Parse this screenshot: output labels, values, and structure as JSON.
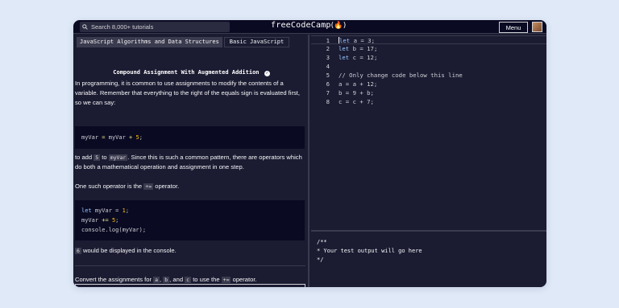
{
  "topbar": {
    "search_placeholder": "Search 8,000+ tutorials",
    "brand": "freeCodeCamp",
    "brand_flame": "(🔥)",
    "menu_label": "Menu"
  },
  "breadcrumb": {
    "superblock": "JavaScript Algorithms and Data Structures",
    "block": "Basic JavaScript"
  },
  "lesson": {
    "title": "Compound Assignment With Augmented Addition",
    "check": "✓",
    "p1": "In programming, it is common to use assignments to modify the contents of a variable. Remember that everything to the right of the equals sign is evaluated first, so we can say:",
    "example1": {
      "var": "myVar",
      "eq": " = ",
      "var2": "myVar",
      "plus": " + ",
      "num": "5",
      "semi": ";"
    },
    "p2a": "to add ",
    "p2_code1": "5",
    "p2b": " to ",
    "p2_code2": "myVar",
    "p2c": ". Since this is such a common pattern, there are operators which do both a mathematical operation and assignment in one step.",
    "p3a": "One such operator is the ",
    "p3_code": "+=",
    "p3b": " operator.",
    "example2": {
      "l1_kw": "let",
      "l1_rest": " myVar = ",
      "l1_num": "1",
      "l1_semi": ";",
      "l2_a": "myVar ",
      "l2_op": "+=",
      "l2_b": " ",
      "l2_num": "5",
      "l2_semi": ";",
      "l3": "console.log(myVar);"
    },
    "p4_code": "6",
    "p4": " would be displayed in the console.",
    "p5a": "Convert the assignments for ",
    "p5_a": "a",
    "p5_comma1": ", ",
    "p5_b": "b",
    "p5_and": ", and ",
    "p5_c": "c",
    "p5_mid": " to use the ",
    "p5_op": "+=",
    "p5_end": " operator."
  },
  "editor": {
    "lines": [
      {
        "num": "1",
        "kw": "let",
        "rest": " a = ",
        "val": "3",
        "end": ";"
      },
      {
        "num": "2",
        "kw": "let",
        "rest": " b = ",
        "val": "17",
        "end": ";"
      },
      {
        "num": "3",
        "kw": "let",
        "rest": " c = ",
        "val": "12",
        "end": ";"
      },
      {
        "num": "4",
        "text": ""
      },
      {
        "num": "5",
        "comment": "// Only change code below this line"
      },
      {
        "num": "6",
        "text": "a = a + 12;"
      },
      {
        "num": "7",
        "text": "b = 9 + b;"
      },
      {
        "num": "8",
        "text": "c = c + 7;"
      }
    ]
  },
  "output": {
    "l1": "/**",
    "l2": "* Your test output will go here",
    "l3": "*/"
  },
  "colors": {
    "background": "#1b1b32",
    "topbar": "#0a0a23",
    "keyword": "#99c9ff",
    "number": "#ffc300",
    "comment": "#6a9955"
  }
}
